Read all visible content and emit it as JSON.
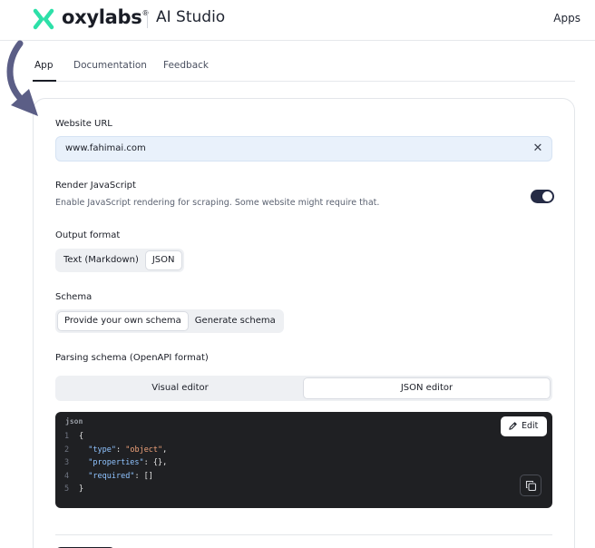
{
  "header": {
    "brand": "oxylabs",
    "brand_mark": "®",
    "product": "AI Studio",
    "apps_label": "Apps"
  },
  "tabs": [
    {
      "label": "App",
      "active": true
    },
    {
      "label": "Documentation",
      "active": false
    },
    {
      "label": "Feedback",
      "active": false
    }
  ],
  "form": {
    "website_url": {
      "label": "Website URL",
      "value": "www.fahimai.com",
      "clear_glyph": "✕"
    },
    "render_js": {
      "label": "Render JavaScript",
      "hint": "Enable JavaScript rendering for scraping. Some website might require that.",
      "enabled": true
    },
    "output_format": {
      "label": "Output format",
      "options": [
        "Text (Markdown)",
        "JSON"
      ],
      "selected": "JSON"
    },
    "schema": {
      "label": "Schema",
      "options": [
        "Provide your own schema",
        "Generate schema"
      ],
      "selected": "Provide your own schema"
    },
    "parsing_schema": {
      "label": "Parsing schema (OpenAPI format)",
      "editor_tabs": [
        "Visual editor",
        "JSON editor"
      ],
      "selected": "JSON editor"
    },
    "code": {
      "lang": "json",
      "edit_label": "Edit",
      "line_numbers": [
        "1",
        "2",
        "3",
        "4",
        "5"
      ],
      "tokens": {
        "open_brace": "{",
        "type_key": "\"type\"",
        "type_colon": ": ",
        "type_value": "\"object\"",
        "comma": ",",
        "properties_key": "\"properties\"",
        "properties_rest": ": {},",
        "required_key": "\"required\"",
        "required_rest": ": []",
        "close_brace": "}"
      }
    }
  },
  "colors": {
    "accent_dark": "#252b45",
    "brand_green": "#2de0a8",
    "arrow": "#5b5e86",
    "input_bg": "#e9f1fb",
    "code_bg": "#1f2023"
  },
  "icons": {
    "logo": "oxylabs-x-logo-icon",
    "clear": "close-icon",
    "edit": "pencil-icon",
    "copy": "copy-icon",
    "pointer": "curved-arrow-icon"
  }
}
